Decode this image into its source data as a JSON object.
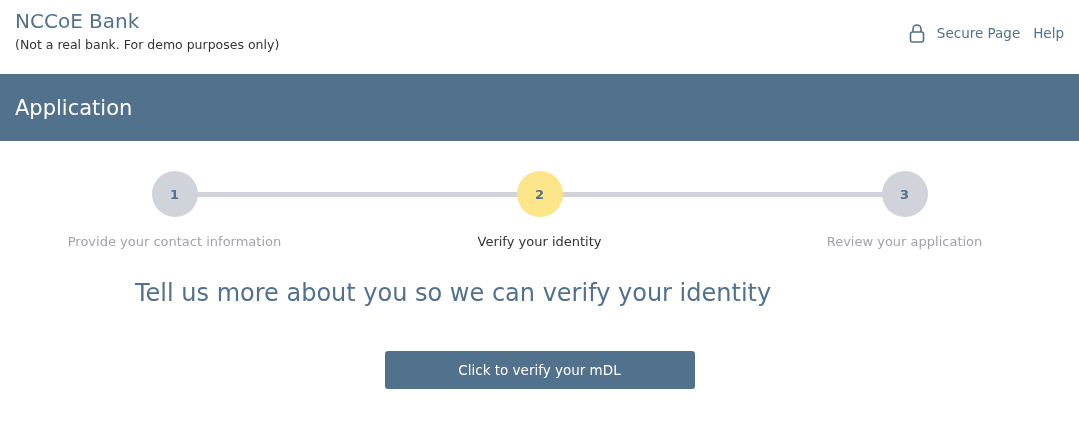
{
  "header": {
    "brand": "NCCoE Bank",
    "subtitle": "(Not a real bank. For demo purposes only)",
    "secure_label": "Secure Page",
    "help_link": "Help"
  },
  "banner": {
    "title": "Application"
  },
  "steps": [
    {
      "number": "1",
      "label": "Provide your contact information",
      "selected": false
    },
    {
      "number": "2",
      "label": "Verify your identity",
      "selected": true
    },
    {
      "number": "3",
      "label": "Review your application",
      "selected": false
    }
  ],
  "heading": "Tell us more about you so we can verify your identity",
  "verify_button": "Click to verify your mDL"
}
